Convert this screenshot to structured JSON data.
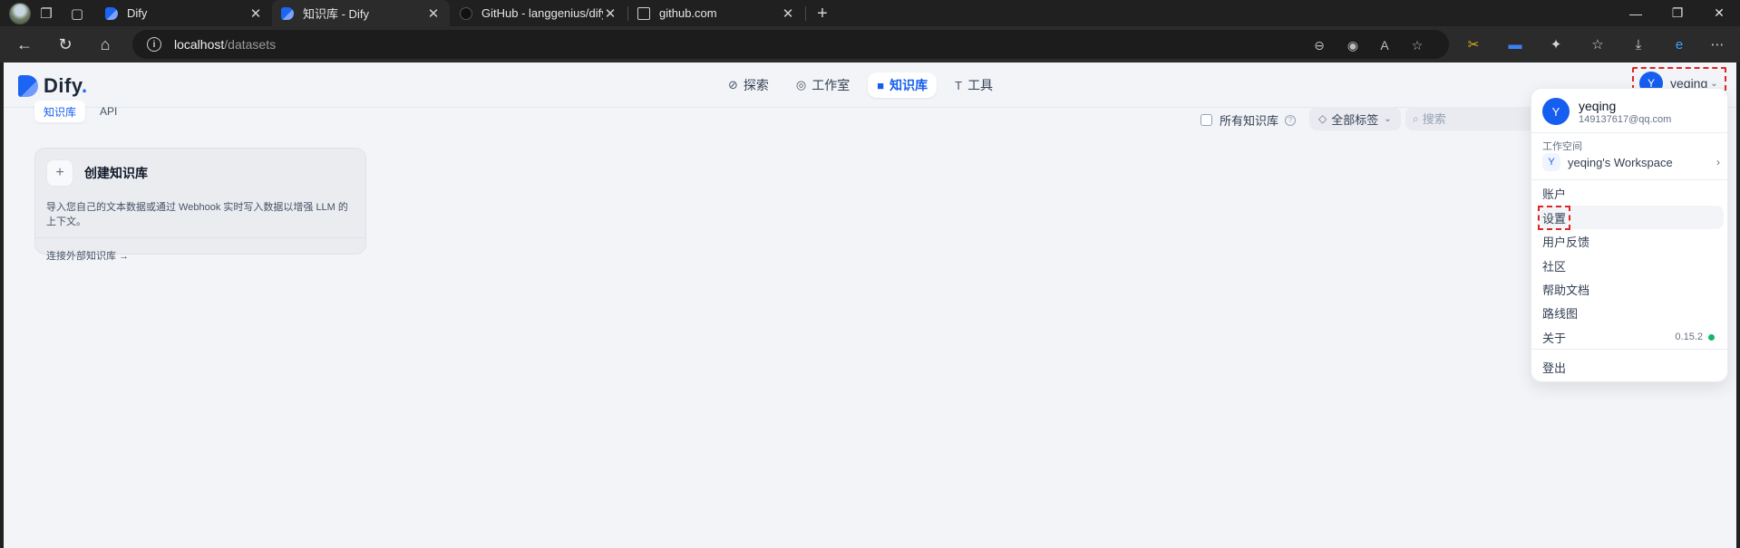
{
  "browser": {
    "tabs": [
      {
        "title": "Dify",
        "favicon": "dify-icon"
      },
      {
        "title": "知识库 - Dify",
        "favicon": "dify-icon"
      },
      {
        "title": "GitHub - langgenius/dify: Dify is a",
        "favicon": "github-icon"
      },
      {
        "title": "github.com",
        "favicon": "doc-icon"
      }
    ],
    "url_host": "localhost",
    "url_path": "/datasets"
  },
  "app": {
    "logo_text": "Dify",
    "logo_dot": ".",
    "nav": [
      {
        "label": "探索",
        "icon": "compass-icon"
      },
      {
        "label": "工作室",
        "icon": "robot-icon"
      },
      {
        "label": "知识库",
        "icon": "book-icon",
        "active": true
      },
      {
        "label": "工具",
        "icon": "hammer-icon"
      }
    ],
    "user": {
      "initial": "Y",
      "name": "yeqing"
    },
    "subtabs": [
      {
        "label": "知识库",
        "active": true
      },
      {
        "label": "API"
      }
    ],
    "filters": {
      "all_datasets_label": "所有知识库",
      "all_tags_label": "全部标签",
      "search_placeholder": "搜索"
    },
    "create_card": {
      "title": "创建知识库",
      "description": "导入您自己的文本数据或通过 Webhook 实时写入数据以增强 LLM 的上下文。",
      "link": "连接外部知识库 →"
    },
    "dropdown": {
      "name": "yeqing",
      "email": "149137617@qq.com",
      "workspace_label": "工作空间",
      "workspace_initial": "Y",
      "workspace_name": "yeqing's Workspace",
      "items": {
        "account": "账户",
        "settings": "设置",
        "feedback": "用户反馈",
        "community": "社区",
        "docs": "帮助文档",
        "roadmap": "路线图",
        "about": "关于",
        "logout": "登出"
      },
      "version": "0.15.2"
    }
  }
}
